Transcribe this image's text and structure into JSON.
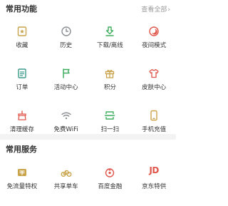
{
  "common_functions": {
    "title": "常用功能",
    "view_all": "查看全部",
    "items": [
      {
        "label": "收藏",
        "icon": "favorites-icon"
      },
      {
        "label": "历史",
        "icon": "history-clock-icon"
      },
      {
        "label": "下载/离线",
        "icon": "download-icon"
      },
      {
        "label": "夜间模式",
        "icon": "night-mode-icon"
      },
      {
        "label": "订单",
        "icon": "order-icon"
      },
      {
        "label": "活动中心",
        "icon": "flag-icon"
      },
      {
        "label": "积分",
        "icon": "points-gift-icon"
      },
      {
        "label": "皮肤中心",
        "icon": "skin-shirt-icon"
      },
      {
        "label": "清理缓存",
        "icon": "clean-cache-icon"
      },
      {
        "label": "免费WiFi",
        "icon": "wifi-icon"
      },
      {
        "label": "扫一扫",
        "icon": "scan-icon"
      },
      {
        "label": "手机充值",
        "icon": "phone-recharge-icon"
      }
    ]
  },
  "common_services": {
    "title": "常用服务",
    "items": [
      {
        "label": "免流量特权",
        "icon": "free-data-icon"
      },
      {
        "label": "共享单车",
        "icon": "bike-icon"
      },
      {
        "label": "百度金融",
        "icon": "finance-icon"
      },
      {
        "label": "京东特供",
        "icon": "jd-icon",
        "icon_text": "JD"
      }
    ]
  },
  "colors": {
    "icon_gold": "#c9a34a",
    "icon_gray": "#8b8f93",
    "icon_green": "#3fae5e",
    "icon_red": "#e0554a",
    "icon_teal": "#3d9b8d",
    "divider": "#f3f3f3"
  }
}
